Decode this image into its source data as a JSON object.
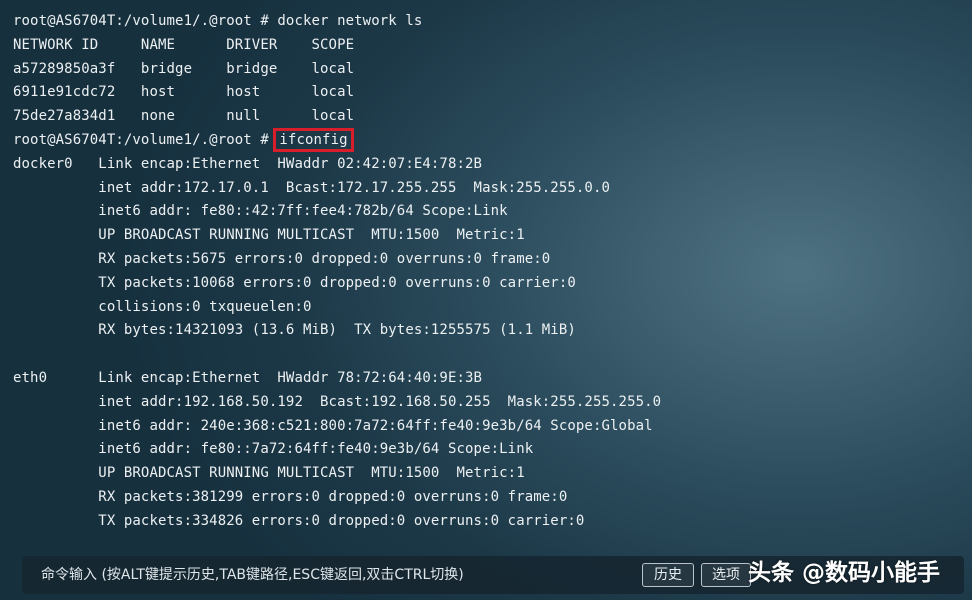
{
  "terminal": {
    "lines": [
      "root@AS6704T:/volume1/.@root # docker network ls",
      "NETWORK ID     NAME      DRIVER    SCOPE",
      "a57289850a3f   bridge    bridge    local",
      "6911e91cdc72   host      host      local",
      "75de27a834d1   none      null      local",
      "root@AS6704T:/volume1/.@root # ",
      "docker0   Link encap:Ethernet  HWaddr 02:42:07:E4:78:2B",
      "          inet addr:172.17.0.1  Bcast:172.17.255.255  Mask:255.255.0.0",
      "          inet6 addr: fe80::42:7ff:fee4:782b/64 Scope:Link",
      "          UP BROADCAST RUNNING MULTICAST  MTU:1500  Metric:1",
      "          RX packets:5675 errors:0 dropped:0 overruns:0 frame:0",
      "          TX packets:10068 errors:0 dropped:0 overruns:0 carrier:0",
      "          collisions:0 txqueuelen:0",
      "          RX bytes:14321093 (13.6 MiB)  TX bytes:1255575 (1.1 MiB)",
      "",
      "eth0      Link encap:Ethernet  HWaddr 78:72:64:40:9E:3B",
      "          inet addr:192.168.50.192  Bcast:192.168.50.255  Mask:255.255.255.0",
      "          inet6 addr: 240e:368:c521:800:7a72:64ff:fe40:9e3b/64 Scope:Global",
      "          inet6 addr: fe80::7a72:64ff:fe40:9e3b/64 Scope:Link",
      "          UP BROADCAST RUNNING MULTICAST  MTU:1500  Metric:1",
      "          RX packets:381299 errors:0 dropped:0 overruns:0 frame:0",
      "          TX packets:334826 errors:0 dropped:0 overruns:0 carrier:0"
    ],
    "highlighted_command": "ifconfig",
    "highlight_color": "#d81e2a"
  },
  "bottom_bar": {
    "command_hint": "命令输入 (按ALT键提示历史,TAB键路径,ESC键返回,双击CTRL切换)",
    "history_button": "历史",
    "options_button": "选项"
  },
  "watermark": {
    "text": "头条 @数码小能手"
  }
}
